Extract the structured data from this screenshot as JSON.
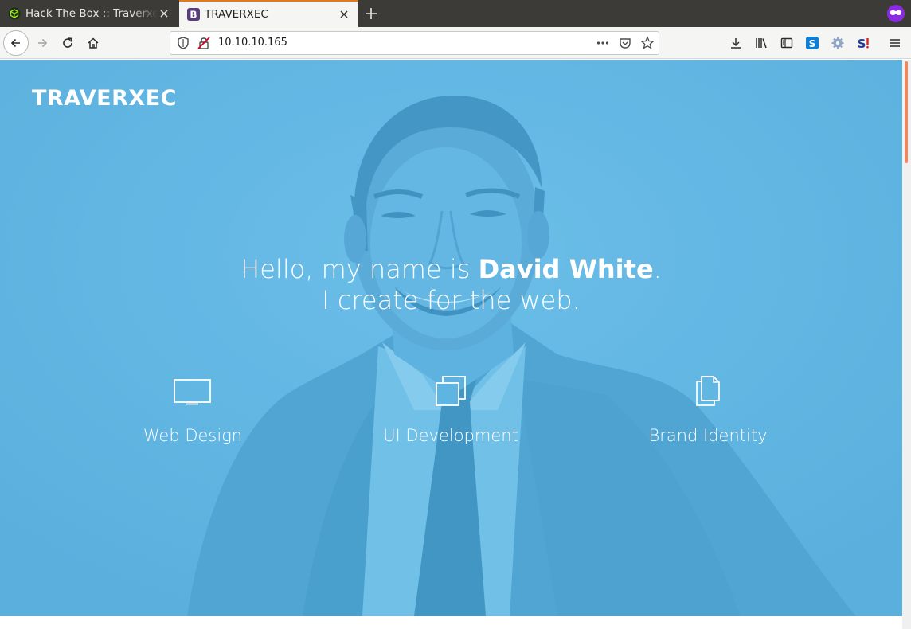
{
  "browser": {
    "tabs": [
      {
        "title": "Hack The Box :: Traverxec",
        "active": false,
        "favicon": "htb-cube-icon"
      },
      {
        "title": "TRAVERXEC",
        "active": true,
        "favicon": "bootstrap-b-icon"
      }
    ],
    "url": "10.10.10.165",
    "colors": {
      "tab_accent": "#e07a1f",
      "private_badge": "#8a2be2"
    }
  },
  "page": {
    "brand": "TRAVERXEC",
    "greeting_prefix": "Hello, my name is ",
    "name": "David White",
    "greeting_suffix": ".",
    "tagline": "I create for the web.",
    "services": [
      {
        "label": "Web Design",
        "icon": "monitor-icon"
      },
      {
        "label": "UI Development",
        "icon": "layers-icon"
      },
      {
        "label": "Brand Identity",
        "icon": "documents-icon"
      }
    ],
    "colors": {
      "hero_blue": "#5eb5e2",
      "scroll_thumb": "#e98a62"
    }
  }
}
